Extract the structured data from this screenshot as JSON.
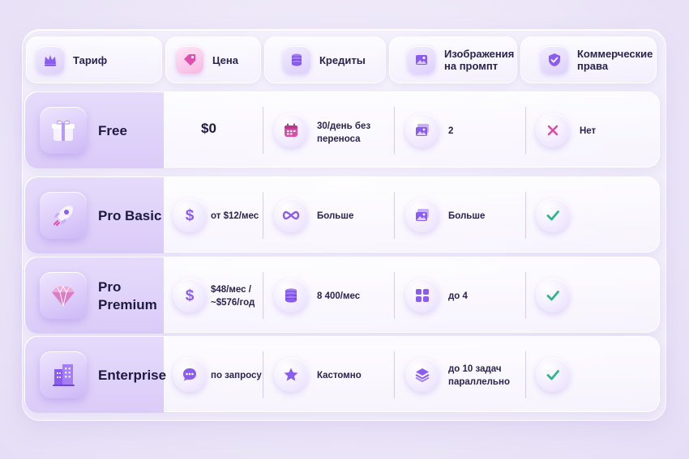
{
  "header": {
    "plan": "Тариф",
    "price": "Цена",
    "credits": "Кредиты",
    "images": "Изображения на промпт",
    "commercial": "Коммерческие права"
  },
  "rows": [
    {
      "name": "Free",
      "price": "$0",
      "credits": "30/день без переноса",
      "images": "2",
      "commercial": "Нет"
    },
    {
      "name": "Pro Basic",
      "price": "от $12/мес",
      "credits": "Больше",
      "images": "Больше",
      "commercial": ""
    },
    {
      "name": "Pro Premium",
      "price": "$48/мес / ~$576/год",
      "credits": "8 400/мес",
      "images": "до 4",
      "commercial": ""
    },
    {
      "name": "Enterprise",
      "price": "по запросу",
      "credits": "Кастомно",
      "images": "до 10 задач параллельно",
      "commercial": ""
    }
  ],
  "icons": {
    "header": [
      "crown-icon",
      "price-tag-icon",
      "coins-icon",
      "image-icon",
      "shield-check-icon"
    ],
    "plans": [
      "gift-icon",
      "rocket-icon",
      "diamond-icon",
      "building-icon"
    ]
  },
  "colors": {
    "accent": "#8a5cf0",
    "yes": "#2fb58a",
    "no": "#d94fa6"
  }
}
